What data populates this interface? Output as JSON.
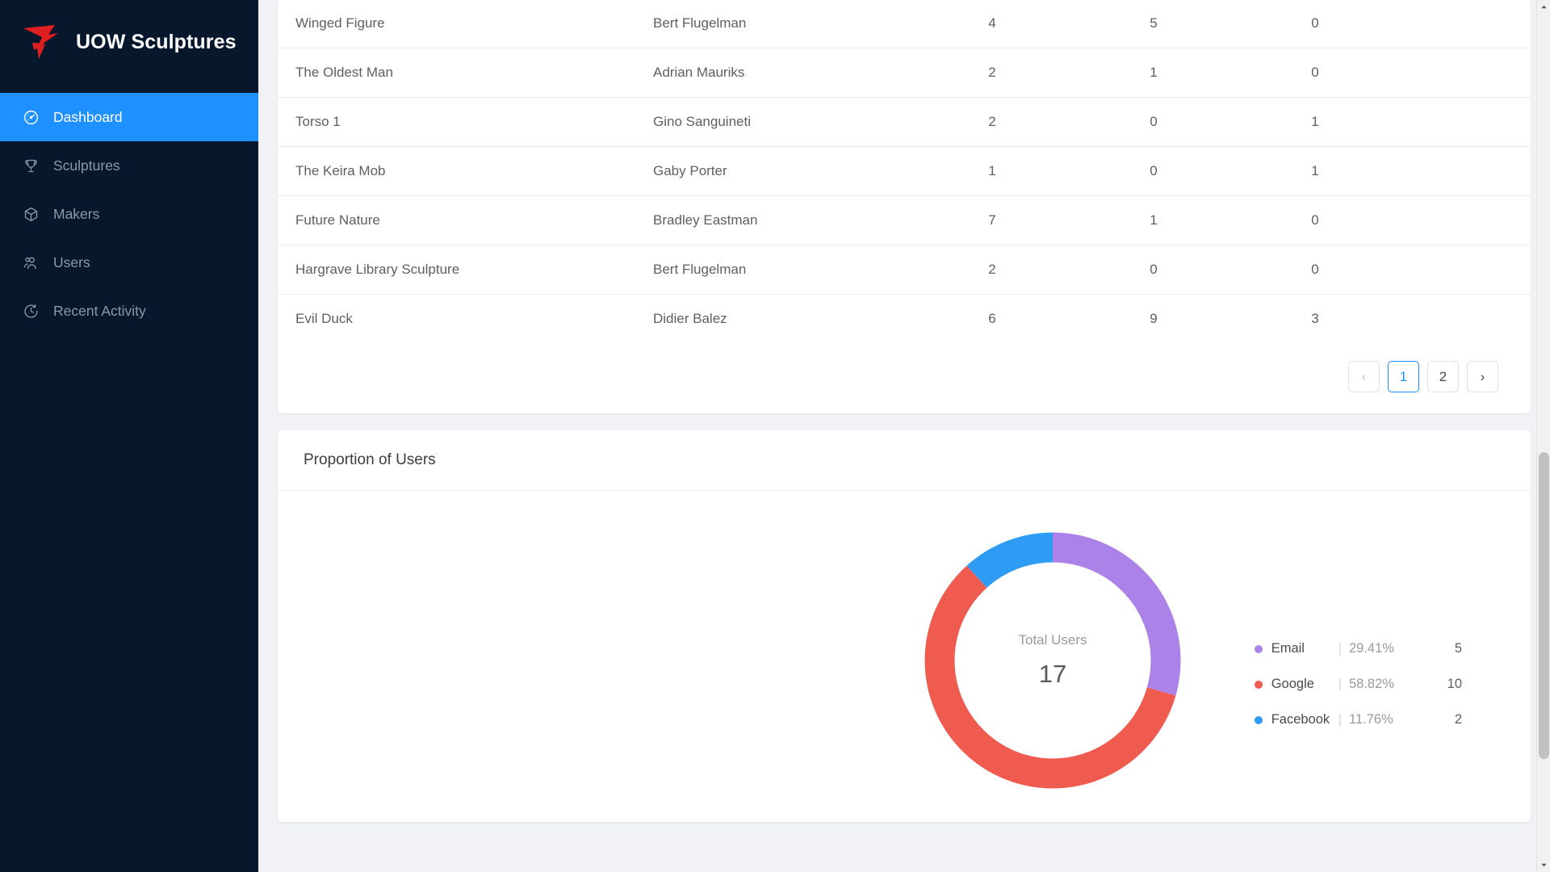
{
  "sidebar": {
    "brand": {
      "title": "UOW Sculptures",
      "logo_icon": "uow-bird-logo"
    },
    "items": [
      {
        "label": "Dashboard",
        "icon": "dashboard-gauge-icon",
        "active": true
      },
      {
        "label": "Sculptures",
        "icon": "trophy-icon",
        "active": false
      },
      {
        "label": "Makers",
        "icon": "cube-box-icon",
        "active": false
      },
      {
        "label": "Users",
        "icon": "users-icon",
        "active": false
      },
      {
        "label": "Recent Activity",
        "icon": "clock-history-icon",
        "active": false
      }
    ]
  },
  "table": {
    "rows": [
      {
        "title": "Winged Figure",
        "maker": "Bert Flugelman",
        "col1": "4",
        "col2": "5",
        "col3": "0"
      },
      {
        "title": "The Oldest Man",
        "maker": "Adrian Mauriks",
        "col1": "2",
        "col2": "1",
        "col3": "0"
      },
      {
        "title": "Torso 1",
        "maker": "Gino Sanguineti",
        "col1": "2",
        "col2": "0",
        "col3": "1"
      },
      {
        "title": "The Keira Mob",
        "maker": "Gaby Porter",
        "col1": "1",
        "col2": "0",
        "col3": "1"
      },
      {
        "title": "Future Nature",
        "maker": "Bradley Eastman",
        "col1": "7",
        "col2": "1",
        "col3": "0"
      },
      {
        "title": "Hargrave Library Sculpture",
        "maker": "Bert Flugelman",
        "col1": "2",
        "col2": "0",
        "col3": "0"
      },
      {
        "title": "Evil Duck",
        "maker": "Didier Balez",
        "col1": "6",
        "col2": "9",
        "col3": "3"
      }
    ],
    "pagination": {
      "prev_label": "‹",
      "next_label": "›",
      "pages": [
        "1",
        "2"
      ],
      "active_page": "1"
    }
  },
  "chart_card": {
    "title": "Proportion of Users"
  },
  "chart_data": {
    "type": "pie",
    "title": "Proportion of Users",
    "center_label": "Total Users",
    "center_value": "17",
    "total": 17,
    "legend_position": "right",
    "categories": [
      "Email",
      "Google",
      "Facebook"
    ],
    "values": [
      5,
      10,
      2
    ],
    "percentages": [
      "29.41%",
      "58.82%",
      "11.76%"
    ],
    "colors": [
      "#ab82e8",
      "#ef5b4f",
      "#2e9cf5"
    ],
    "legend": [
      {
        "name": "Email",
        "pct": "29.41%",
        "count": "5",
        "color": "#ab82e8"
      },
      {
        "name": "Google",
        "pct": "58.82%",
        "count": "10",
        "color": "#ef5b4f"
      },
      {
        "name": "Facebook",
        "pct": "11.76%",
        "count": "2",
        "color": "#2e9cf5"
      }
    ]
  },
  "theme": {
    "accent": "#1e90ff",
    "sidebar_bg": "#07182c",
    "page_bg": "#f0f2f5",
    "logo_red": "#e02020"
  }
}
